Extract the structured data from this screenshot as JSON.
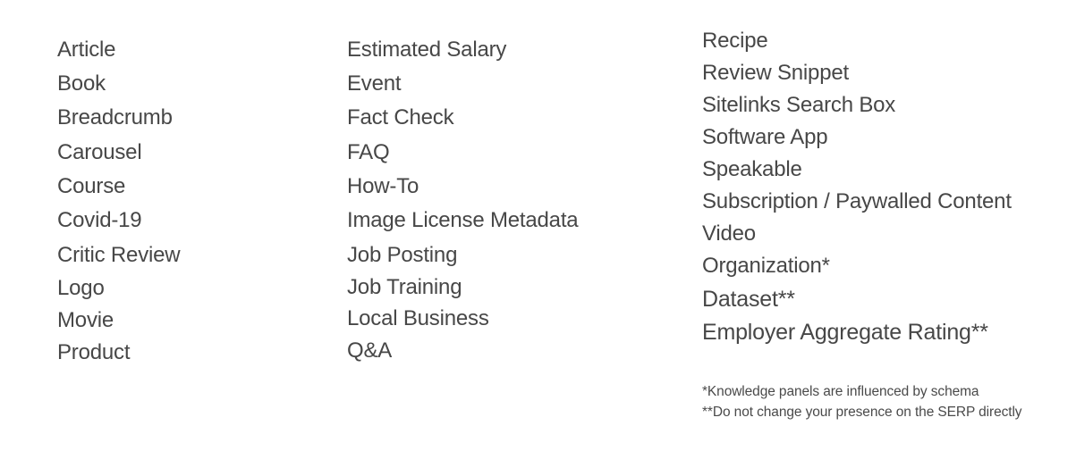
{
  "columns": [
    {
      "items": [
        "Article",
        "Book",
        "Breadcrumb",
        "Carousel",
        "Course",
        "Covid-19",
        "Critic Review",
        "Logo",
        "Movie",
        "Product"
      ]
    },
    {
      "items": [
        "Estimated Salary",
        "Event",
        "Fact Check",
        "FAQ",
        "How-To",
        "Image License Metadata",
        "Job Posting",
        "Job Training",
        "Local Business",
        "Q&A"
      ]
    },
    {
      "items": [
        "Recipe",
        "Review Snippet",
        "Sitelinks Search Box",
        "Software App",
        "Speakable",
        "Subscription / Paywalled Content",
        "Video",
        "Organization*",
        "Dataset**",
        "Employer Aggregate Rating**"
      ]
    }
  ],
  "footnotes": [
    "*Knowledge panels are influenced by schema",
    "**Do not change your presence on the SERP directly"
  ],
  "colors": {
    "text": "#474747",
    "background": "#ffffff"
  }
}
